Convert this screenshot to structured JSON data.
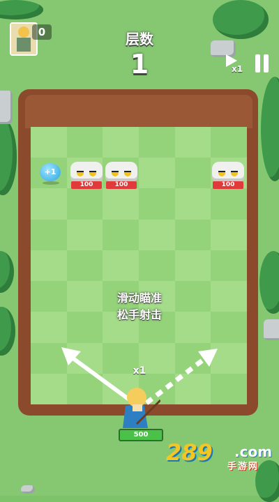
{
  "hud": {
    "coins": "0",
    "level_label": "层数",
    "level_value": "1",
    "speed_label": "x1"
  },
  "board": {
    "bonus_ball": "+1",
    "enemies": [
      {
        "hp": "100"
      },
      {
        "hp": "100"
      },
      {
        "hp": "100"
      }
    ]
  },
  "hint": {
    "line1": "滑动瞄准",
    "line2": "松手射击"
  },
  "player": {
    "ball_multiplier": "x1",
    "hp": "500"
  },
  "watermark": {
    "number": "289",
    "suffix": ".com",
    "site": "手游网"
  },
  "colors": {
    "grass": "#86c872",
    "pit_wall": "#8b4a2b",
    "board_light": "#a4dc8a",
    "board_dark": "#95d37b",
    "hp_bar_enemy": "#e03a3a",
    "hp_bar_player": "#4cc14a"
  }
}
